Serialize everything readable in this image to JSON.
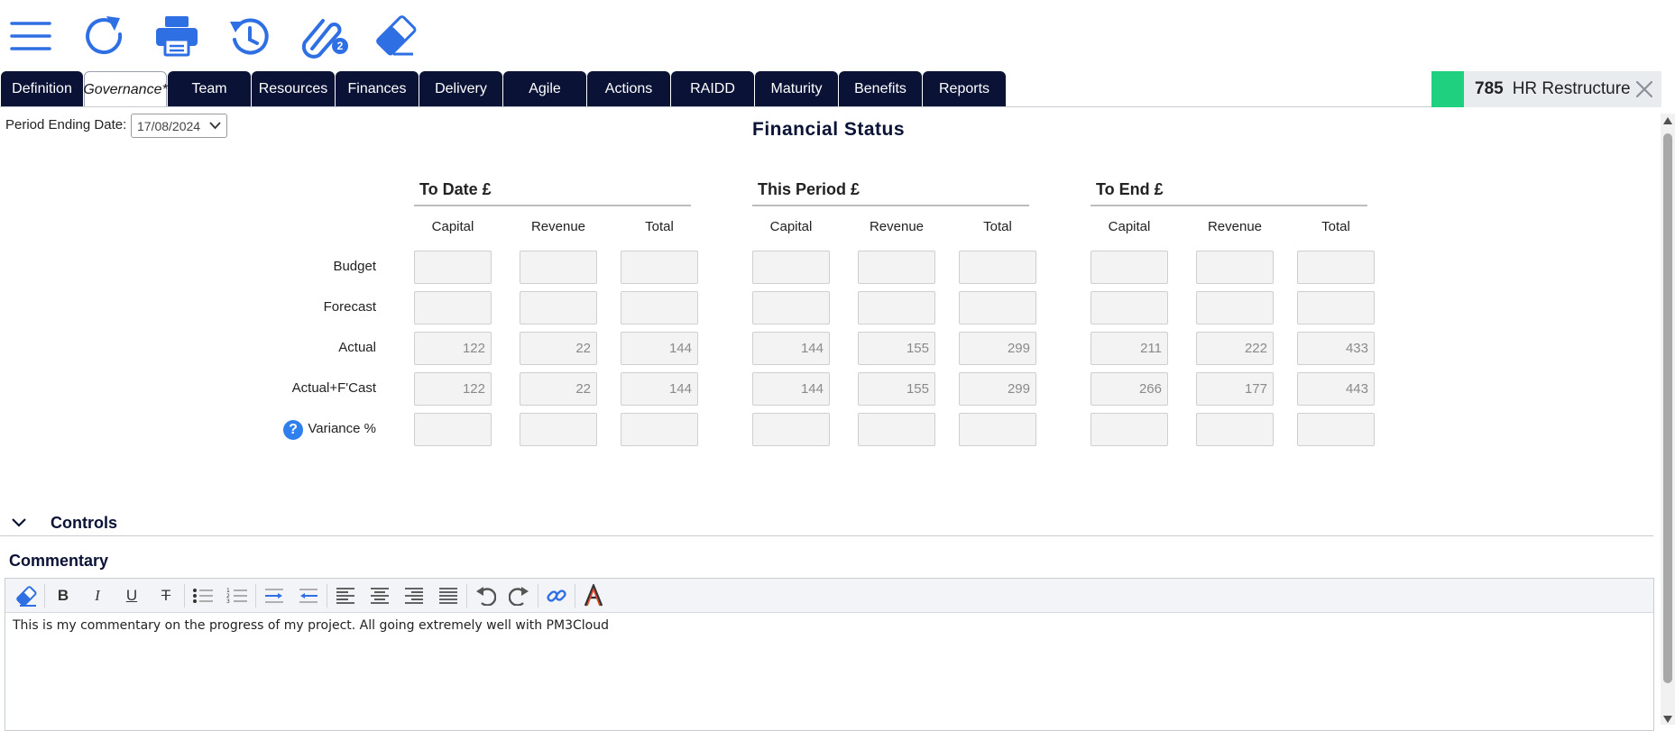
{
  "toolbar": {
    "icons": [
      "menu-icon",
      "refresh-icon",
      "print-icon",
      "history-icon",
      "attachment-icon",
      "eraser-icon"
    ],
    "attachment_count": "2",
    "accent_color": "#2f6fe4"
  },
  "tabs": [
    {
      "label": "Definition",
      "active": false
    },
    {
      "label": "Governance*",
      "active": true
    },
    {
      "label": "Team",
      "active": false
    },
    {
      "label": "Resources",
      "active": false
    },
    {
      "label": "Finances",
      "active": false
    },
    {
      "label": "Delivery",
      "active": false
    },
    {
      "label": "Agile",
      "active": false
    },
    {
      "label": "Actions",
      "active": false
    },
    {
      "label": "RAIDD",
      "active": false
    },
    {
      "label": "Maturity",
      "active": false
    },
    {
      "label": "Benefits",
      "active": false
    },
    {
      "label": "Reports",
      "active": false
    }
  ],
  "project": {
    "id": "785",
    "name": "HR Restructure",
    "status_color": "#1fd17e"
  },
  "period": {
    "label": "Period Ending Date:",
    "value": "17/08/2024"
  },
  "financial_status": {
    "title": "Financial Status",
    "groups": [
      {
        "title": "To Date £"
      },
      {
        "title": "This Period £"
      },
      {
        "title": "To End £"
      }
    ],
    "columns": [
      "Capital",
      "Revenue",
      "Total"
    ],
    "rows": [
      {
        "label": "Budget",
        "values": [
          "",
          "",
          "",
          "",
          "",
          "",
          "",
          "",
          ""
        ]
      },
      {
        "label": "Forecast",
        "values": [
          "",
          "",
          "",
          "",
          "",
          "",
          "",
          "",
          ""
        ]
      },
      {
        "label": "Actual",
        "values": [
          "122",
          "22",
          "144",
          "144",
          "155",
          "299",
          "211",
          "222",
          "433"
        ]
      },
      {
        "label": "Actual+F'Cast",
        "values": [
          "122",
          "22",
          "144",
          "144",
          "155",
          "299",
          "266",
          "177",
          "443"
        ]
      },
      {
        "label": "Variance %",
        "values": [
          "",
          "",
          "",
          "",
          "",
          "",
          "",
          "",
          ""
        ],
        "help": "?"
      }
    ]
  },
  "controls": {
    "label": "Controls",
    "expanded": false
  },
  "commentary": {
    "title": "Commentary",
    "toolbar_tools": [
      "clear-format-icon",
      "bold-icon",
      "italic-icon",
      "underline-icon",
      "strikethrough-icon",
      "bullet-list-icon",
      "numbered-list-icon",
      "indent-icon",
      "outdent-icon",
      "align-left-icon",
      "align-center-icon",
      "align-right-icon",
      "justify-icon",
      "undo-icon",
      "redo-icon",
      "link-icon",
      "font-color-icon"
    ],
    "toolbar_glyphs": {
      "bold": "B",
      "italic": "I",
      "underline": "U",
      "strike": "T"
    },
    "text": "This is my commentary on the progress of my project. All going extremely well with PM3Cloud"
  }
}
